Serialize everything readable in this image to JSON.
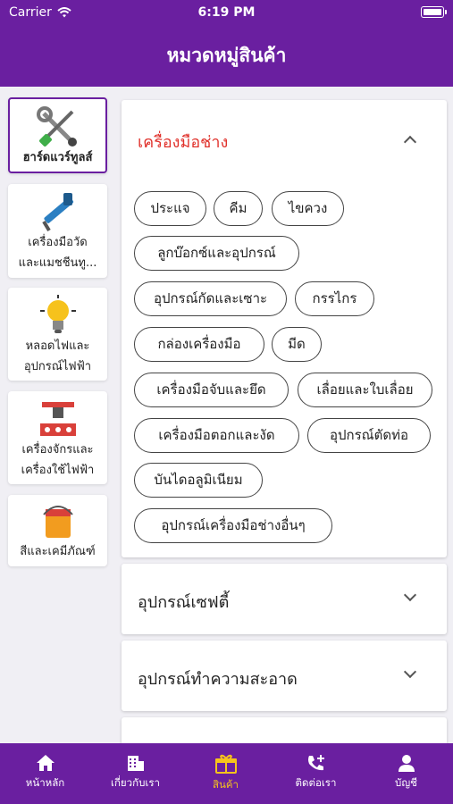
{
  "status_bar": {
    "carrier": "Carrier",
    "time": "6:19 PM"
  },
  "header": {
    "title": "หมวดหมู่สินค้า"
  },
  "sidebar": {
    "items": [
      {
        "label": "ฮาร์ดแวร์ทูลส์",
        "icon": "tools-icon"
      },
      {
        "label": "เครื่องมือวัด",
        "label2": "และแมชชีนทู...",
        "icon": "caliper-icon"
      },
      {
        "label": "หลอดไฟและ",
        "label2": "อุปกรณ์ไฟฟ้า",
        "icon": "lightbulb-icon"
      },
      {
        "label": "เครื่องจักรและ",
        "label2": "เครื่องใช้ไฟฟ้า",
        "icon": "machine-icon"
      },
      {
        "label": "สีและเคมีภัณฑ์",
        "icon": "paint-bucket-icon"
      }
    ]
  },
  "sections": [
    {
      "title": "เครื่องมือช่าง",
      "expanded": true,
      "chips": [
        "ประแจ",
        "คีม",
        "ไขควง",
        "ลูกบ๊อกซ์และอุปกรณ์",
        "อุปกรณ์กัดและเซาะ",
        "กรรไกร",
        "กล่องเครื่องมือ",
        "มีด",
        "เครื่องมือจับและยึด",
        "เลื่อยและใบเลื่อย",
        "เครื่องมือตอกและงัด",
        "อุปกรณ์ตัดท่อ",
        "บันไดอลูมิเนียม",
        "อุปกรณ์เครื่องมือช่างอื่นๆ"
      ]
    },
    {
      "title": "อุปกรณ์เซฟตี้",
      "expanded": false
    },
    {
      "title": "อุปกรณ์ทำความสะอาด",
      "expanded": false
    }
  ],
  "tabbar": {
    "items": [
      {
        "label": "หน้าหลัก",
        "icon": "home-icon"
      },
      {
        "label": "เกี่ยวกับเรา",
        "icon": "building-icon"
      },
      {
        "label": "สินค้า",
        "icon": "gift-box-icon",
        "active": true
      },
      {
        "label": "ติดต่อเรา",
        "icon": "phone-add-icon"
      },
      {
        "label": "บัญชี",
        "icon": "person-icon"
      }
    ]
  },
  "colors": {
    "primary": "#6a1fa0",
    "active_tab": "#f6c21c",
    "section_open": "#e0312b"
  }
}
